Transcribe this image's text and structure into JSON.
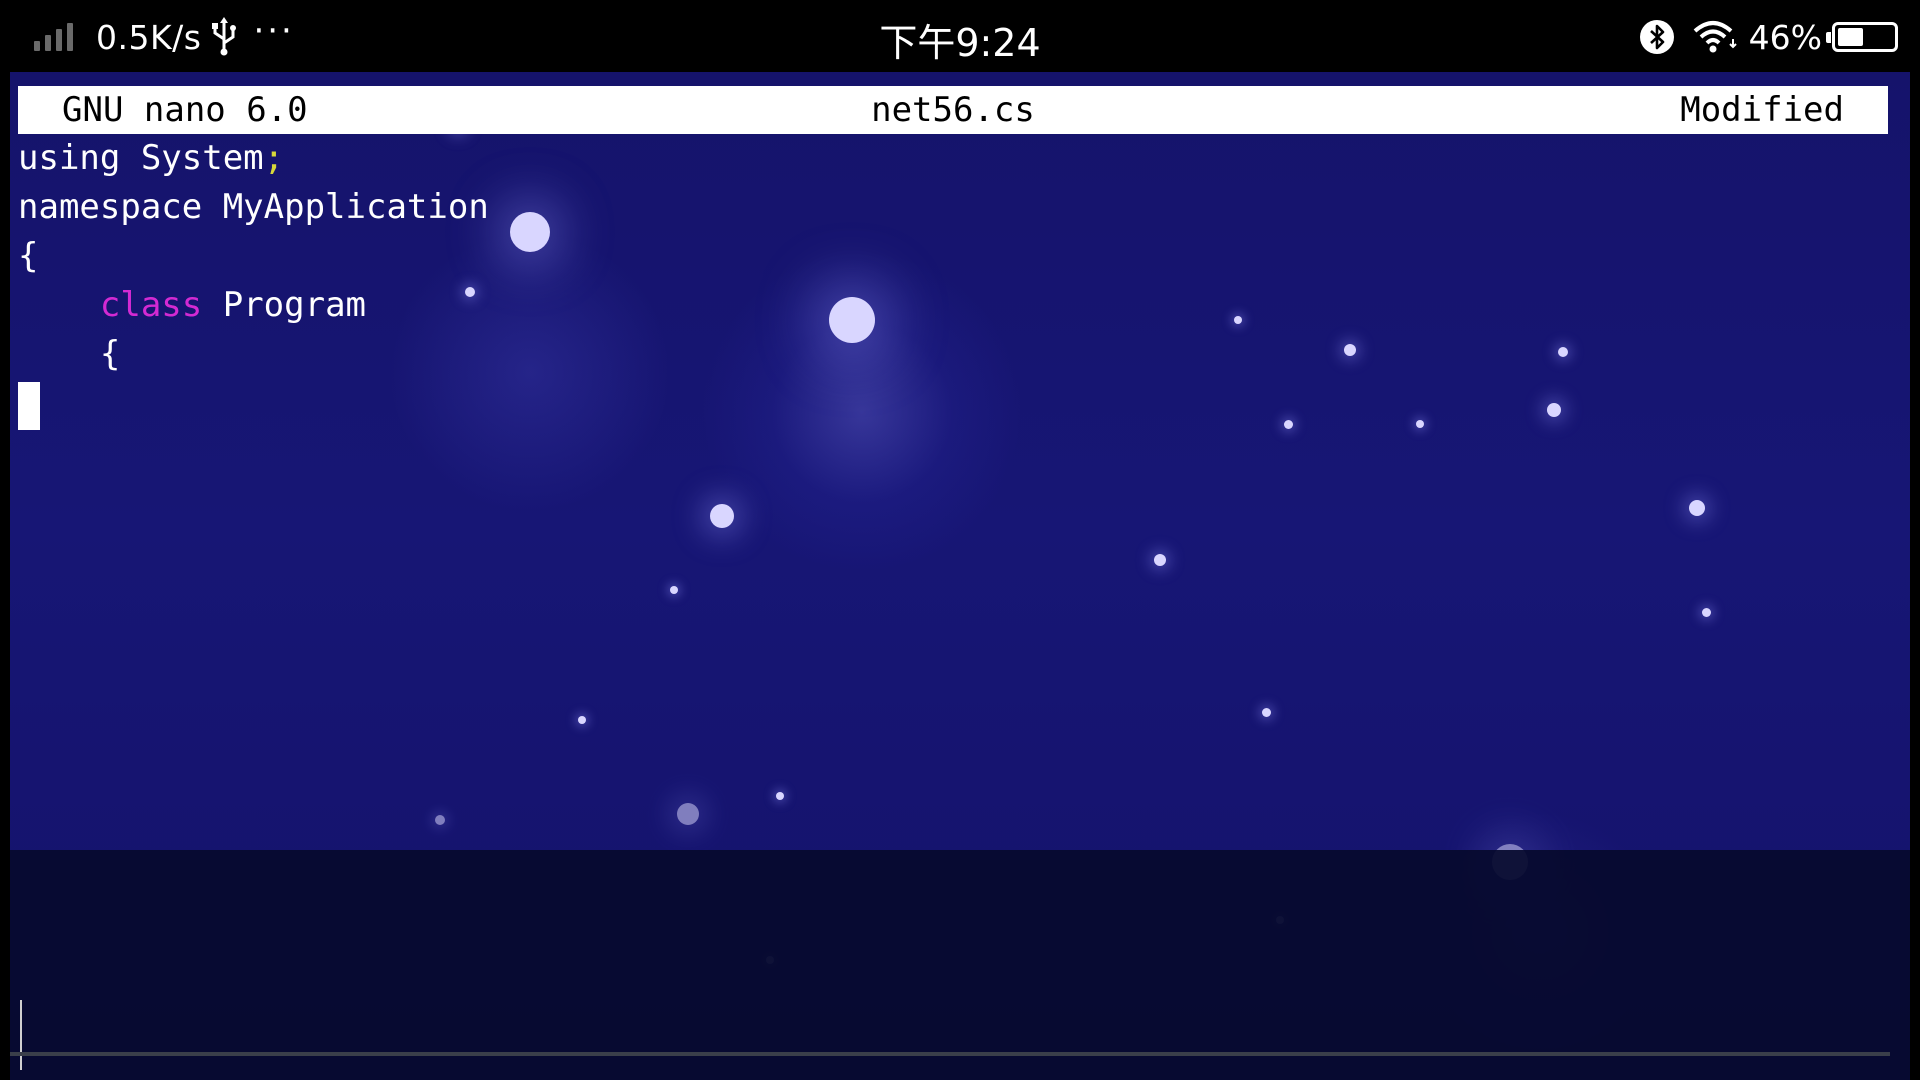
{
  "status_bar": {
    "network_speed": "0.5K/s",
    "more_indicator": "···",
    "clock": "下午9:24",
    "battery_percent": "46%",
    "battery_level": 0.46,
    "icons": [
      "signal-icon",
      "usb-icon",
      "bluetooth-icon",
      "wifi-icon",
      "battery-icon"
    ]
  },
  "nano": {
    "version_label": "GNU nano 6.0",
    "filename": "net56.cs",
    "state": "Modified"
  },
  "code_lines": [
    {
      "tokens": [
        {
          "text": "using System",
          "kind": "plain"
        },
        {
          "text": ";",
          "kind": "semicolon"
        }
      ]
    },
    {
      "tokens": [
        {
          "text": "namespace MyApplication",
          "kind": "plain"
        }
      ]
    },
    {
      "tokens": [
        {
          "text": "{",
          "kind": "plain"
        }
      ]
    },
    {
      "tokens": [
        {
          "text": "    ",
          "kind": "plain"
        },
        {
          "text": "class",
          "kind": "keyword"
        },
        {
          "text": " Program",
          "kind": "plain"
        }
      ]
    },
    {
      "tokens": [
        {
          "text": "    {",
          "kind": "plain"
        }
      ]
    }
  ],
  "colors": {
    "background": "#15136b",
    "keyword": "#d32ad3",
    "semicolon": "#d8d83a",
    "text": "#ffffff",
    "titlebar_bg": "#ffffff"
  }
}
